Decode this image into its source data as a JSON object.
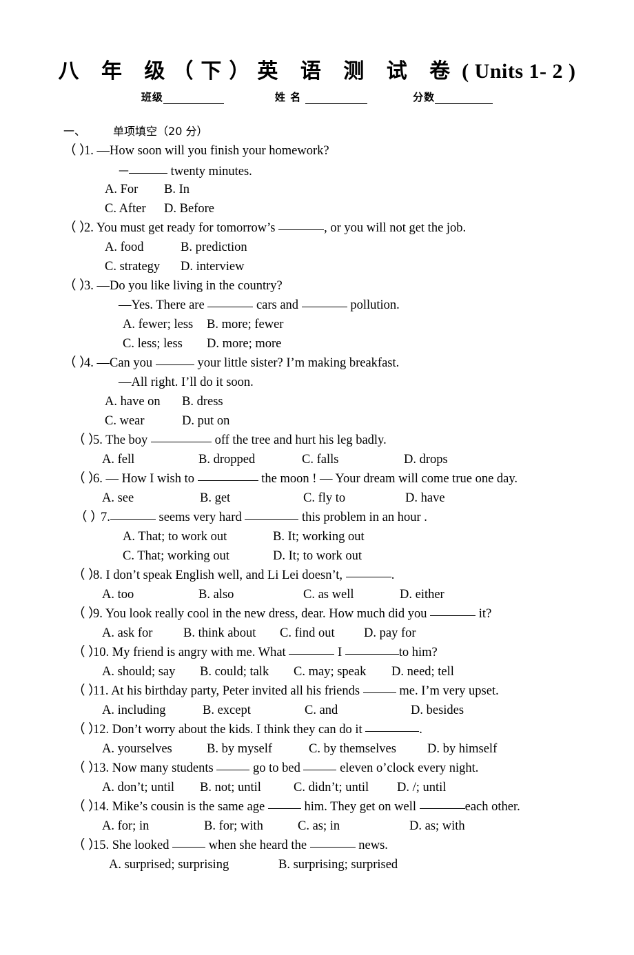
{
  "document": {
    "title_cn": "八 年 级（下）英 语 测 试 卷",
    "title_en": "( Units 1- 2 )",
    "fields": [
      {
        "label": "班级",
        "value": ""
      },
      {
        "label": "姓 名",
        "value": ""
      },
      {
        "label": "分数",
        "value": ""
      }
    ],
    "section": {
      "number": "一、",
      "heading": "单项填空（20 分）"
    },
    "bracket": "（  ）",
    "questions": [
      {
        "num": "1.",
        "stem": "—How soon will you finish your homework?",
        "stem2_pre": "—",
        "stem2_post": " twenty minutes.",
        "options": [
          "A. For",
          "B. In",
          "C. After",
          "D. Before"
        ],
        "layout": "2col"
      },
      {
        "num": "2.",
        "stem_pre": "You must get ready for tomorrow’s ",
        "stem_post": ", or you will not get the job.",
        "options": [
          "A. food",
          "B. prediction",
          "C. strategy",
          "D. interview"
        ],
        "layout": "2col"
      },
      {
        "num": "3.",
        "stem": "—Do you like living in the country?",
        "stem2_pre": "—Yes. There are ",
        "stem2_mid": " cars and ",
        "stem2_post": " pollution.",
        "options": [
          "A. fewer; less",
          "B. more; fewer",
          "C. less; less",
          "D. more; more"
        ],
        "layout": "2col"
      },
      {
        "num": "4.",
        "stem_pre": "—Can you ",
        "stem_post": " your little sister? I’m making breakfast.",
        "stem2": "—All right. I’ll do it soon.",
        "options": [
          "A. have on",
          "B. dress",
          "C. wear",
          "D. put on"
        ],
        "layout": "2col"
      },
      {
        "num": "5.",
        "stem_pre": "The boy ",
        "stem_post": " off the tree and hurt his leg badly.",
        "options": [
          "A. fell",
          "B. dropped",
          "C. falls",
          "D. drops"
        ],
        "layout": "4col"
      },
      {
        "num": "6.",
        "stem_pre": "— How I wish to ",
        "stem_post": " the moon ! — Your dream will come true one day.",
        "options": [
          "A. see",
          "B. get",
          "C. fly to",
          "D. have"
        ],
        "layout": "4col"
      },
      {
        "num": "7.",
        "stem_pre": "",
        "stem_mid": " seems very hard ",
        "stem_post": " this problem in an hour .",
        "options": [
          "A. That; to work out",
          "B. It; working out",
          "C. That; working out",
          "D. It; to work out"
        ],
        "layout": "2col-wide"
      },
      {
        "num": "8.",
        "stem_pre": "I don’t speak English well, and Li Lei doesn’t, ",
        "stem_post": ".",
        "options": [
          "A. too",
          "B. also",
          "C. as well",
          "D. either"
        ],
        "layout": "4col"
      },
      {
        "num": "9.",
        "stem_pre": "You look really cool in the new dress, dear. How much did you ",
        "stem_post": " it?",
        "options": [
          "A. ask for",
          "B. think about",
          "C. find out",
          "D. pay for"
        ],
        "layout": "4col"
      },
      {
        "num": "10.",
        "stem_pre": "My friend is angry with me. What ",
        "stem_mid": " I ",
        "stem_post": "to him?",
        "options": [
          "A. should; say",
          "B. could; talk",
          "C. may; speak",
          "D. need; tell"
        ],
        "layout": "4col"
      },
      {
        "num": "11.",
        "stem_pre": "At his birthday party, Peter invited all his friends ",
        "stem_post": " me. I’m very upset.",
        "options": [
          "A. including",
          "B. except",
          "C. and",
          "D. besides"
        ],
        "layout": "4col"
      },
      {
        "num": "12.",
        "stem_pre": "Don’t worry about the kids. I think they can do it ",
        "stem_post": ".",
        "options": [
          "A. yourselves",
          "B. by myself",
          "C. by themselves",
          "D. by himself"
        ],
        "layout": "4col"
      },
      {
        "num": "13.",
        "stem_pre": "Now many students ",
        "stem_mid": " go to bed ",
        "stem_post": " eleven o’clock every night.",
        "options": [
          "A. don’t; until",
          "B. not; until",
          "C. didn’t; until",
          "D. /; until"
        ],
        "layout": "4col"
      },
      {
        "num": "14.",
        "stem_pre": "Mike’s cousin is the same age ",
        "stem_mid": " him. They get on well ",
        "stem_post": "each other.",
        "options": [
          "A. for; in",
          "B. for; with",
          "C. as; in",
          "D. as; with"
        ],
        "layout": "4col"
      },
      {
        "num": "15.",
        "stem_pre": "She looked ",
        "stem_mid": " when she heard the ",
        "stem_post": " news.",
        "options": [
          "A. surprised; surprising",
          "B. surprising; surprised"
        ],
        "layout": "2col-last"
      }
    ]
  }
}
